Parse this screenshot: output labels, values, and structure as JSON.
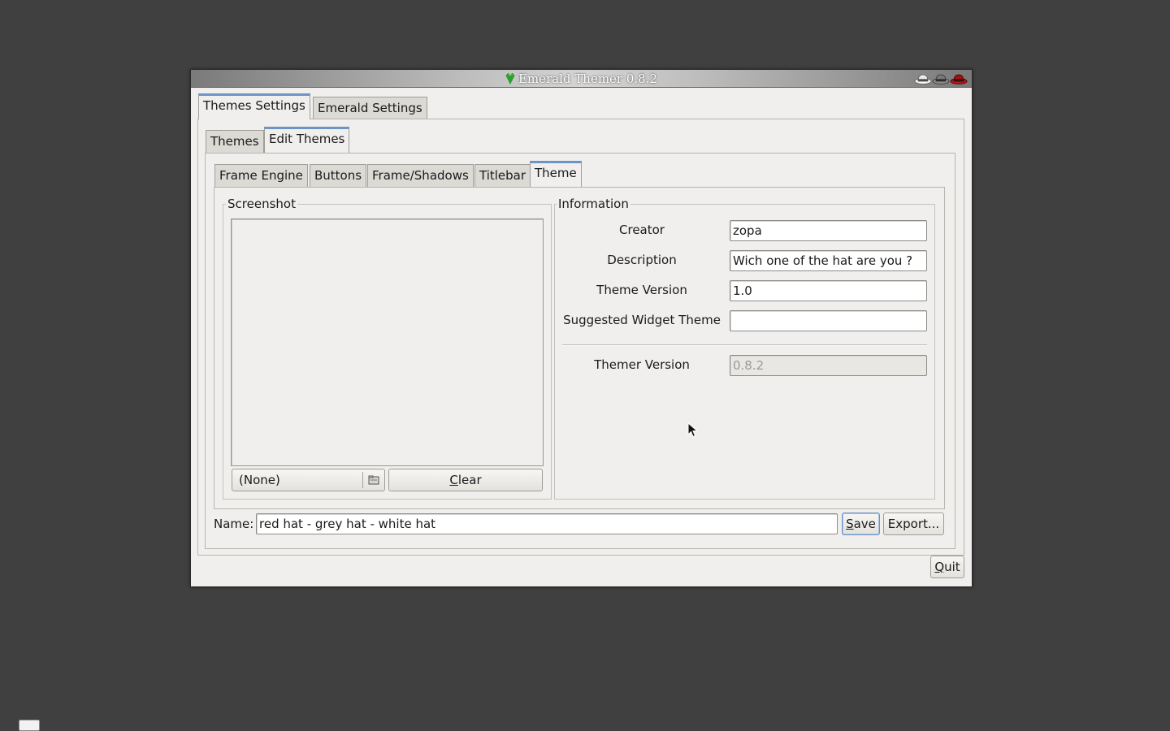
{
  "window": {
    "title": "Emerald Themer 0.8.2"
  },
  "top_tabs": [
    {
      "label": "Themes Settings",
      "active": true
    },
    {
      "label": "Emerald Settings",
      "active": false
    }
  ],
  "sub_tabs": [
    {
      "label": "Themes",
      "active": false
    },
    {
      "label": "Edit Themes",
      "active": true
    }
  ],
  "edit_tabs": [
    {
      "label": "Frame Engine",
      "active": false
    },
    {
      "label": "Buttons",
      "active": false
    },
    {
      "label": "Frame/Shadows",
      "active": false
    },
    {
      "label": "Titlebar",
      "active": false
    },
    {
      "label": "Theme",
      "active": true
    }
  ],
  "screenshot": {
    "group_label": "Screenshot",
    "file_value": "(None)",
    "clear_prefix": "",
    "clear_mnemonic": "C",
    "clear_rest": "lear"
  },
  "information": {
    "group_label": "Information",
    "fields": [
      {
        "label": "Creator",
        "value": "zopa"
      },
      {
        "label": "Description",
        "value": "Wich one of the hat are you ?"
      },
      {
        "label": "Theme Version",
        "value": "1.0"
      },
      {
        "label": "Suggested Widget Theme",
        "value": ""
      }
    ],
    "themer_version_label": "Themer Version",
    "themer_version_value": "0.8.2"
  },
  "name_row": {
    "label": "Name:",
    "value": "red hat - grey hat - white hat",
    "save_mnemonic": "S",
    "save_rest": "ave",
    "export_label": "Export..."
  },
  "quit": {
    "mnemonic": "Q",
    "rest": "uit"
  },
  "colors": {
    "accent": "#6d95c4",
    "desktop": "#404040",
    "window_bg": "#f0efed"
  }
}
